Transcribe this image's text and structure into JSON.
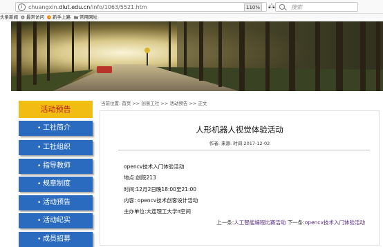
{
  "browser": {
    "url_host": "chuangxin.",
    "url_domain": "dlut.edu.cn",
    "url_path": "/info/1063/5521.htm",
    "zoom": "110%",
    "menu_dots": "•••",
    "bookmark_star": "☆",
    "search_placeholder": "搜索"
  },
  "bookmarks": [
    {
      "label": "头条新闻",
      "icon": "none"
    },
    {
      "label": "最常访问",
      "icon": "gear-icon"
    },
    {
      "label": "新手上路",
      "icon": "firefox-icon"
    },
    {
      "label": "常用网址",
      "icon": "folder-icon"
    }
  ],
  "sidebar": {
    "title": "活动预告",
    "items": [
      {
        "label": "工社简介"
      },
      {
        "label": "工社组织"
      },
      {
        "label": "指导教师"
      },
      {
        "label": "规章制度"
      },
      {
        "label": "活动预告"
      },
      {
        "label": "活动纪实"
      },
      {
        "label": "成员招募"
      }
    ],
    "bullet": "•"
  },
  "breadcrumb": {
    "prefix": "当前位置:",
    "home": "首页",
    "sep": ">>",
    "c1": "创意工社",
    "c2": "活动预告",
    "c3": "正文"
  },
  "article": {
    "title": "人形机器人视觉体验活动",
    "meta": "作者:  来源:  时间:2017-12-02",
    "lines": [
      "opencv技术入门体验活动",
      "地点:创院213",
      "时间:12月2日晚18:00至21:00",
      "内容: opencv技术创客设计活动",
      "主办单位:大连理工大学π空间"
    ]
  },
  "nav": {
    "prev_prefix": "上一条:",
    "prev_title": "人工智能编程比赛活动",
    "next_prefix": "下一条:",
    "next_title": "opencv技术入门体验活动"
  },
  "colors": {
    "sidebar_blue": "#2a6bc0",
    "sidebar_title_bg": "#f2bd13",
    "sidebar_title_text": "#b5191c",
    "nav_link": "#5a2a8a"
  }
}
